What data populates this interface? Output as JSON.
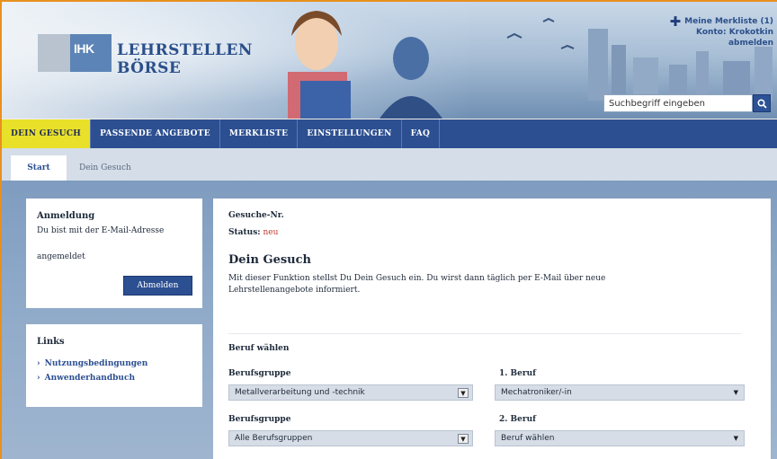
{
  "header": {
    "logo_text": "IHK",
    "title_line1": "LEHRSTELLEN",
    "title_line2": "BÖRSE",
    "merkliste": "Meine Merkliste (1)",
    "konto_label": "Konto:",
    "konto_user": "Krokotkin",
    "logout_link": "abmelden",
    "search_placeholder": "Suchbegriff eingeben"
  },
  "nav": {
    "tabs": [
      {
        "label": "DEIN GESUCH",
        "active": true
      },
      {
        "label": "PASSENDE ANGEBOTE",
        "active": false
      },
      {
        "label": "MERKLISTE",
        "active": false
      },
      {
        "label": "EINSTELLUNGEN",
        "active": false
      },
      {
        "label": "FAQ",
        "active": false
      }
    ]
  },
  "breadcrumb": {
    "items": [
      "Start",
      "Dein Gesuch"
    ]
  },
  "login_box": {
    "title": "Anmeldung",
    "text1": "Du bist mit der E-Mail-Adresse",
    "text2": "angemeldet",
    "button": "Abmelden"
  },
  "links_box": {
    "title": "Links",
    "items": [
      "Nutzungsbedingungen",
      "Anwenderhandbuch"
    ]
  },
  "main": {
    "gesuch_nr_label": "Gesuche-Nr.",
    "status_label": "Status:",
    "status_value": "neu",
    "title": "Dein Gesuch",
    "description": "Mit dieser Funktion stellst Du Dein Gesuch ein. Du wirst dann täglich per E-Mail über neue Lehrstellenangebote informiert.",
    "section_title": "Beruf wählen",
    "fields": [
      {
        "label": "Berufsgruppe",
        "value": "Metallverarbeitung und -technik"
      },
      {
        "label": "1. Beruf",
        "value": "Mechatroniker/-in"
      },
      {
        "label": "Berufsgruppe",
        "value": "Alle Berufsgruppen"
      },
      {
        "label": "2. Beruf",
        "value": "Beruf wählen"
      }
    ]
  },
  "colors": {
    "nav_blue": "#2c4f91",
    "active_tab_yellow": "#e9e02a",
    "status_red": "#c0392b",
    "frame_orange": "#e8901e"
  }
}
